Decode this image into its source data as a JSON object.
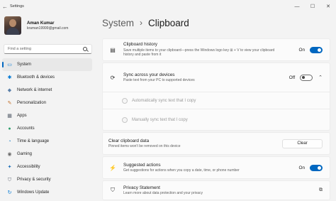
{
  "window": {
    "title": "Settings",
    "back_glyph": "←",
    "minimize_glyph": "—",
    "maximize_glyph": "☐",
    "close_glyph": "✕"
  },
  "profile": {
    "name": "Aman Kumar",
    "email": "kraman19999@gmail.com"
  },
  "search": {
    "placeholder": "Find a setting"
  },
  "nav": {
    "items": [
      {
        "label": "System",
        "icon": "monitor-icon",
        "glyph": "▭",
        "color": "#0078d4"
      },
      {
        "label": "Bluetooth & devices",
        "icon": "bluetooth-icon",
        "glyph": "✱",
        "color": "#0078d4"
      },
      {
        "label": "Network & internet",
        "icon": "wifi-icon",
        "glyph": "◆",
        "color": "#5a7fa8"
      },
      {
        "label": "Personalization",
        "icon": "brush-icon",
        "glyph": "✎",
        "color": "#c2702a"
      },
      {
        "label": "Apps",
        "icon": "apps-icon",
        "glyph": "▦",
        "color": "#5b6470"
      },
      {
        "label": "Accounts",
        "icon": "person-icon",
        "glyph": "●",
        "color": "#2e9e6b"
      },
      {
        "label": "Time & language",
        "icon": "globe-clock-icon",
        "glyph": "◔",
        "color": "#1b7fc4"
      },
      {
        "label": "Gaming",
        "icon": "gamepad-icon",
        "glyph": "◉",
        "color": "#6b6b6b"
      },
      {
        "label": "Accessibility",
        "icon": "accessibility-icon",
        "glyph": "✦",
        "color": "#1f6fb8"
      },
      {
        "label": "Privacy & security",
        "icon": "shield-icon",
        "glyph": "⛉",
        "color": "#6e7680"
      },
      {
        "label": "Windows Update",
        "icon": "update-icon",
        "glyph": "↻",
        "color": "#0078d4"
      }
    ]
  },
  "breadcrumb": {
    "parent": "System",
    "separator": "›",
    "current": "Clipboard"
  },
  "settings": {
    "history": {
      "title": "Clipboard history",
      "desc": "Save multiple items to your clipboard—press the Windows logo key ⊞ + V to view your clipboard history and paste from it",
      "state": "On",
      "icon_glyph": "▤"
    },
    "sync": {
      "title": "Sync across your devices",
      "desc": "Paste text from your PC to supported devices",
      "state": "Off",
      "icon_glyph": "⟳",
      "chevron": "⌃"
    },
    "auto_sync": {
      "label": "Automatically sync text that I copy"
    },
    "manual_sync": {
      "label": "Manually sync text that I copy"
    },
    "clear": {
      "title": "Clear clipboard data",
      "desc": "Pinned items won't be removed on this device",
      "button": "Clear"
    },
    "suggested": {
      "title": "Suggested actions",
      "desc": "Get suggestions for actions when you copy a date, time, or phone number",
      "state": "On",
      "icon_glyph": "⚡"
    },
    "privacy": {
      "title": "Privacy Statement",
      "desc": "Learn more about data protection and your privacy",
      "icon_glyph": "⛉",
      "ext_glyph": "⧉"
    }
  }
}
